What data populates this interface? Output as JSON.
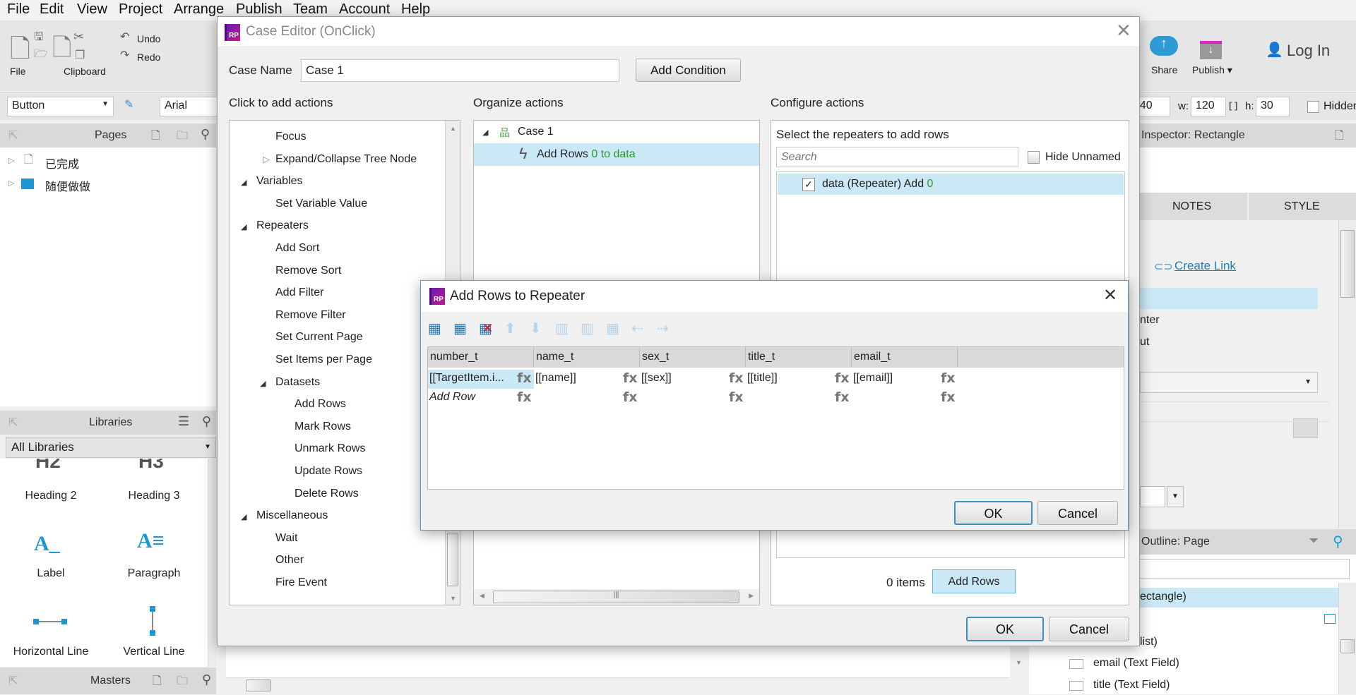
{
  "menu": [
    "File",
    "Edit",
    "View",
    "Project",
    "Arrange",
    "Publish",
    "Team",
    "Account",
    "Help"
  ],
  "toolbar": {
    "file": "File",
    "clipboard": "Clipboard",
    "undo": "Undo",
    "redo": "Redo",
    "share": "Share",
    "publish": "Publish ▾",
    "login": "Log In"
  },
  "toolbar2": {
    "widget_type": "Button",
    "font": "Arial",
    "y_value": "140",
    "w_label": "w:",
    "w_value": "120",
    "h_label": "h:",
    "h_value": "30",
    "hidden_label": "Hidden"
  },
  "pages": {
    "title": "Pages",
    "items": [
      "已完成",
      "随便做做"
    ]
  },
  "libraries": {
    "title": "Libraries",
    "selected": "All Libraries",
    "widgets": [
      "Heading 2",
      "Heading 3",
      "Label",
      "Paragraph",
      "Horizontal Line",
      "Vertical Line"
    ]
  },
  "masters": {
    "title": "Masters"
  },
  "inspector": {
    "title": "Inspector: Rectangle",
    "tabs": [
      "NOTES",
      "STYLE"
    ],
    "create_link": "Create Link",
    "partial1": "nter",
    "partial2": "ut"
  },
  "outline": {
    "title": "Outline: Page",
    "items": [
      "ectangle)",
      "list)",
      "email (Text Field)",
      "title (Text Field)"
    ]
  },
  "case_editor": {
    "title": "Case Editor (OnClick)",
    "case_name_label": "Case Name",
    "case_name_value": "Case 1",
    "add_condition": "Add Condition",
    "col1": "Click to add actions",
    "col2": "Organize actions",
    "col3": "Configure actions",
    "actions": [
      {
        "label": "Focus",
        "level": 2
      },
      {
        "label": "Expand/Collapse Tree Node",
        "level": 2,
        "collapsed": true
      },
      {
        "label": "Variables",
        "level": 1,
        "expanded": true
      },
      {
        "label": "Set Variable Value",
        "level": 2
      },
      {
        "label": "Repeaters",
        "level": 1,
        "expanded": true
      },
      {
        "label": "Add Sort",
        "level": 2
      },
      {
        "label": "Remove Sort",
        "level": 2
      },
      {
        "label": "Add Filter",
        "level": 2
      },
      {
        "label": "Remove Filter",
        "level": 2
      },
      {
        "label": "Set Current Page",
        "level": 2
      },
      {
        "label": "Set Items per Page",
        "level": 2
      },
      {
        "label": "Datasets",
        "level": 2,
        "expanded": true
      },
      {
        "label": "Add Rows",
        "level": 3
      },
      {
        "label": "Mark Rows",
        "level": 3
      },
      {
        "label": "Unmark Rows",
        "level": 3
      },
      {
        "label": "Update Rows",
        "level": 3
      },
      {
        "label": "Delete Rows",
        "level": 3
      },
      {
        "label": "Miscellaneous",
        "level": 1,
        "expanded": true
      },
      {
        "label": "Wait",
        "level": 2
      },
      {
        "label": "Other",
        "level": 2
      },
      {
        "label": "Fire Event",
        "level": 2
      }
    ],
    "organize": {
      "case": "Case 1",
      "action": "Add Rows",
      "action_detail": "0 to data"
    },
    "configure": {
      "heading": "Select the repeaters to add rows",
      "search_placeholder": "Search",
      "hide_unnamed": "Hide Unnamed",
      "repeater": "data (Repeater) Add",
      "repeater_count": "0",
      "repeater_checked": true,
      "items_count": "0 items",
      "add_rows": "Add Rows"
    },
    "ok": "OK",
    "cancel": "Cancel"
  },
  "add_rows_dialog": {
    "title": "Add Rows to Repeater",
    "toolbar_icons": [
      "insert-row-above-icon",
      "insert-row-below-icon",
      "delete-row-icon",
      "move-up-icon",
      "move-down-icon",
      "insert-column-left-icon",
      "insert-column-right-icon",
      "delete-column-icon",
      "move-left-icon",
      "move-right-icon"
    ],
    "columns": [
      "number_t",
      "name_t",
      "sex_t",
      "title_t",
      "email_t"
    ],
    "rows": [
      [
        "[[TargetItem.i...",
        "[[name]]",
        "[[sex]]",
        "[[title]]",
        "[[email]]"
      ]
    ],
    "add_row": "Add Row",
    "fx": "fx",
    "ok": "OK",
    "cancel": "Cancel"
  },
  "colors": {
    "accent": "#3c8fc0",
    "selection": "#cbe8f6",
    "green": "#2a9a2a",
    "brand": "#8a1fb0"
  }
}
